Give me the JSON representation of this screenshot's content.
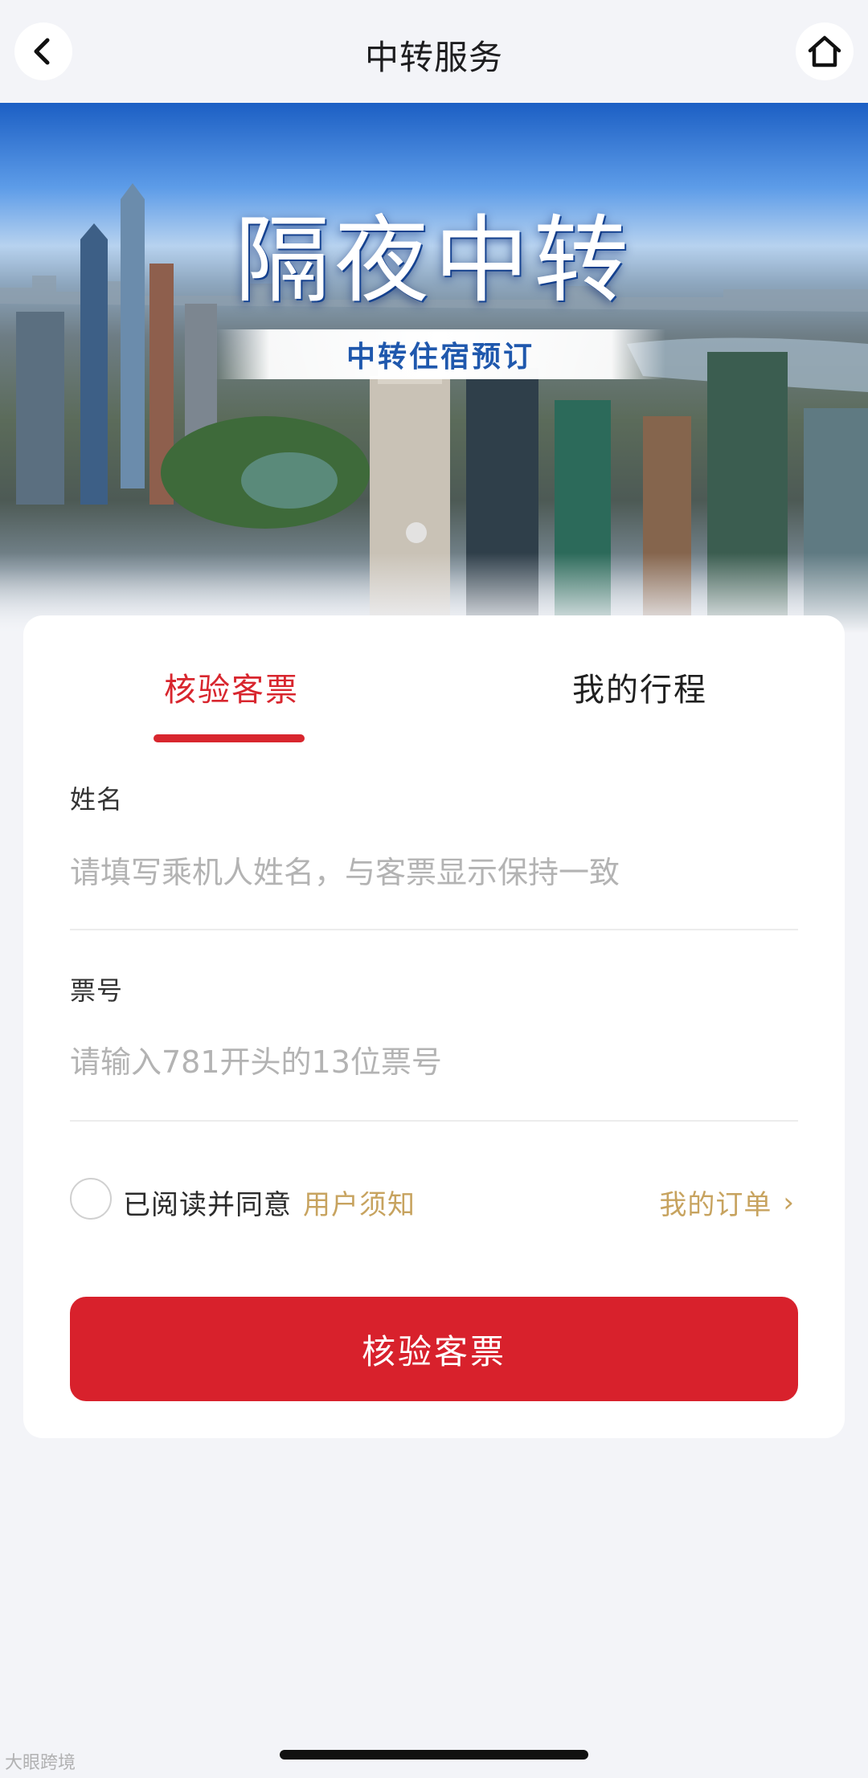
{
  "header": {
    "title": "中转服务",
    "back_icon": "chevron-left-icon",
    "home_icon": "home-icon"
  },
  "banner": {
    "title": "隔夜中转",
    "subtitle": "中转住宿预订"
  },
  "tabs": [
    {
      "label": "核验客票",
      "active": true
    },
    {
      "label": "我的行程",
      "active": false
    }
  ],
  "form": {
    "name_label": "姓名",
    "name_placeholder": "请填写乘机人姓名，与客票显示保持一致",
    "ticket_label": "票号",
    "ticket_placeholder": "请输入781开头的13位票号"
  },
  "agreement": {
    "text": "已阅读并同意",
    "link": "用户须知",
    "checked": false
  },
  "orders_link": {
    "label": "我的订单",
    "chevron": "›"
  },
  "submit_label": "核验客票",
  "watermark": "大眼跨境",
  "colors": {
    "accent": "#d8262e",
    "gold_link": "#c7a35f",
    "background": "#f3f4f8"
  }
}
